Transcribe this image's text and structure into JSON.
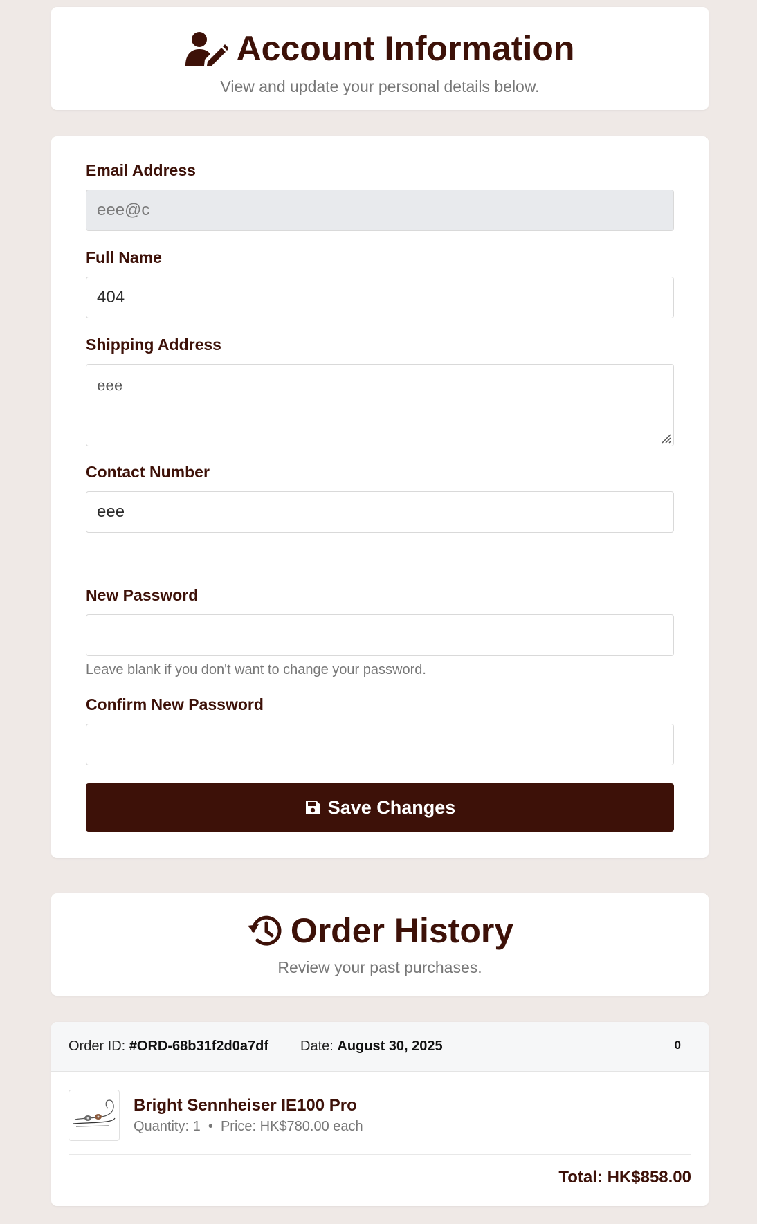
{
  "account": {
    "title": "Account Information",
    "subtitle": "View and update your personal details below.",
    "icon": "user-edit-icon"
  },
  "form": {
    "email_label": "Email Address",
    "email_value": "eee@c",
    "name_label": "Full Name",
    "name_value": "404",
    "address_label": "Shipping Address",
    "address_value": "eee",
    "contact_label": "Contact Number",
    "contact_value": "eee",
    "new_password_label": "New Password",
    "new_password_value": "",
    "password_hint": "Leave blank if you don't want to change your password.",
    "confirm_password_label": "Confirm New Password",
    "confirm_password_value": "",
    "save_label": "Save Changes",
    "save_icon": "save-icon"
  },
  "orders": {
    "title": "Order History",
    "subtitle": "Review your past purchases.",
    "icon": "history-icon",
    "list": [
      {
        "order_id_label": "Order ID:",
        "order_id": "#ORD-68b31f2d0a7df",
        "date_label": "Date:",
        "date": "August 30, 2025",
        "status": "0",
        "items": [
          {
            "name": "Bright Sennheiser IE100 Pro",
            "detail": "Quantity: 1  •  Price: HK$780.00 each",
            "image": "earphones-thumbnail"
          }
        ],
        "total": "Total: HK$858.00"
      }
    ]
  },
  "colors": {
    "brand": "#3d1108",
    "background": "#efe9e6",
    "muted_text": "#777777",
    "disabled_field": "#e8eaed"
  }
}
